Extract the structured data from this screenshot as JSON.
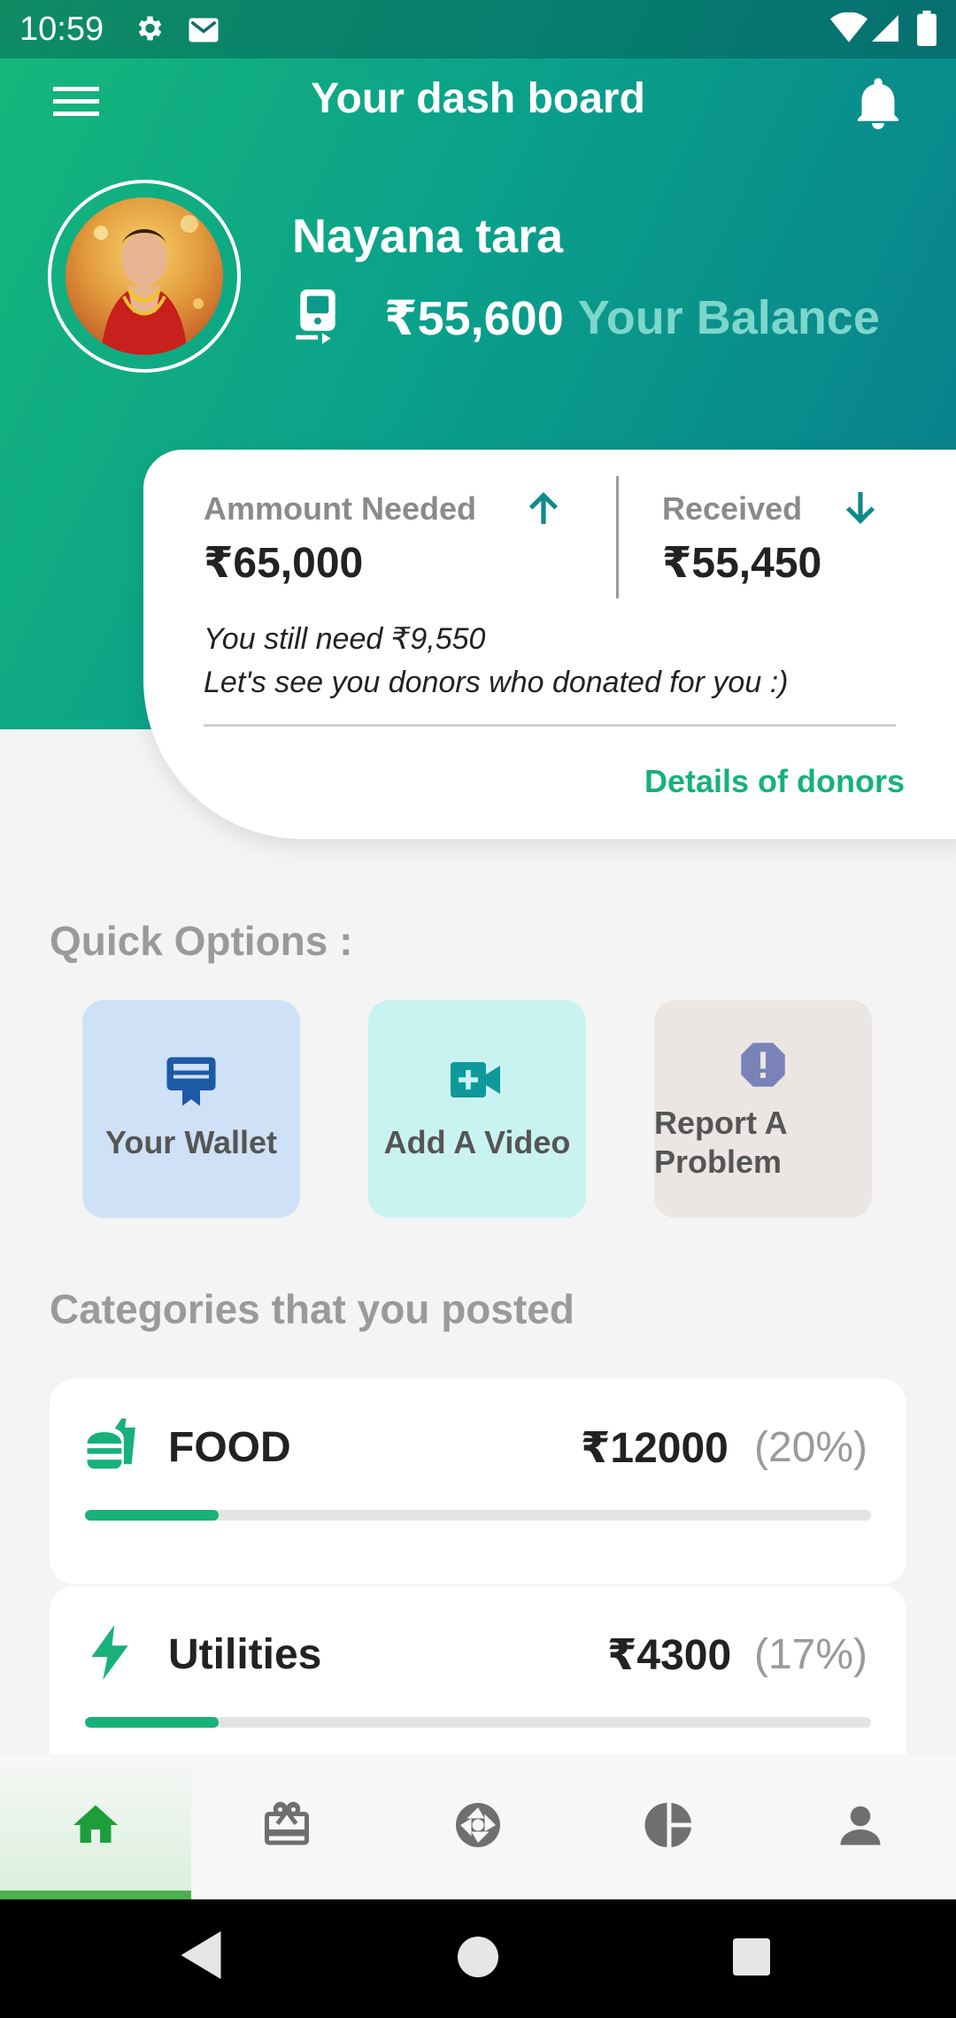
{
  "status_bar": {
    "time": "10:59",
    "icons": [
      "settings-icon",
      "gmail-icon",
      "wifi-icon",
      "signal-icon",
      "battery-icon"
    ]
  },
  "app_bar": {
    "title": "Your dash board",
    "icons": [
      "menu-icon",
      "bell-icon"
    ]
  },
  "profile": {
    "name": "Nayana tara",
    "balance_amount": "₹55,600",
    "balance_label": "Your Balance"
  },
  "summary": {
    "needed_label": "Ammount Needed",
    "needed_value": "₹65,000",
    "received_label": "Received",
    "received_value": "₹55,450",
    "note_line1": "You still need ₹9,550",
    "note_line2": "Let's see you donors who donated for you :)",
    "details_link": "Details of donors"
  },
  "quick_options": {
    "title": "Quick Options :",
    "items": [
      {
        "label": "Your Wallet",
        "icon": "wallet-icon"
      },
      {
        "label": "Add A Video",
        "icon": "video-add-icon"
      },
      {
        "label_line1": "Report A",
        "label_line2": "Problem",
        "icon": "alert-icon"
      }
    ]
  },
  "categories": {
    "title": "Categories that you posted",
    "items": [
      {
        "name": "FOOD",
        "amount": "₹12000",
        "percent": "(20%)",
        "progress": 0.17,
        "icon": "food-icon"
      },
      {
        "name": "Utilities",
        "amount": "₹4300",
        "percent": "(17%)",
        "progress": 0.17,
        "icon": "bolt-icon"
      }
    ]
  },
  "colors": {
    "accent": "#17b179",
    "header_start": "#16b77a",
    "header_end": "#097c8c",
    "nav_active": "#4caf50"
  },
  "bottom_nav": {
    "items": [
      "home-icon",
      "gift-icon",
      "aperture-icon",
      "pie-chart-icon",
      "person-icon"
    ],
    "active": 0
  }
}
